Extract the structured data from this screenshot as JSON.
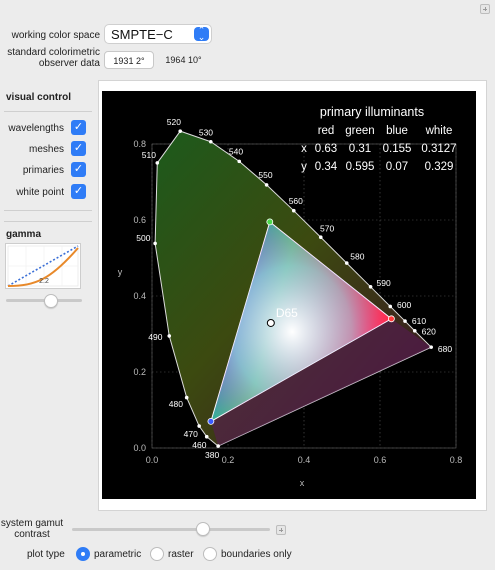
{
  "controls": {
    "working_color_space_label": "working color space",
    "working_color_space_value": "SMPTE−C",
    "observer_label_line1": "standard colorimetric",
    "observer_label_line2": "observer data",
    "observer_options": [
      "1931 2°",
      "1964 10°"
    ],
    "observer_selected": "1931 2°"
  },
  "visual_control": {
    "title": "visual control",
    "items": [
      {
        "label": "wavelengths",
        "checked": true
      },
      {
        "label": "meshes",
        "checked": true
      },
      {
        "label": "primaries",
        "checked": true
      },
      {
        "label": "white point",
        "checked": true
      }
    ]
  },
  "gamma": {
    "title": "gamma",
    "value_label": "2.2",
    "curve_color": "#e8892a",
    "reference_color": "#3a6fd6"
  },
  "table": {
    "title": "primary illuminants",
    "headers": [
      "red",
      "green",
      "blue",
      "white"
    ],
    "row_x_label": "x",
    "row_y_label": "y",
    "x_values": [
      "0.63",
      "0.31",
      "0.155",
      "0.3127"
    ],
    "y_values": [
      "0.34",
      "0.595",
      "0.07",
      "0.329"
    ]
  },
  "chart_data": {
    "type": "scatter",
    "title": "",
    "xlabel": "x",
    "ylabel": "y",
    "xlim": [
      0,
      0.8
    ],
    "ylim": [
      0,
      0.8
    ],
    "xticks": [
      "0.0",
      "0.2",
      "0.4",
      "0.6",
      "0.8"
    ],
    "yticks": [
      "0.0",
      "0.2",
      "0.4",
      "0.6",
      "0.8"
    ],
    "grid": true,
    "white_point_label": "D65",
    "white_point": [
      0.3127,
      0.329
    ],
    "primaries": {
      "red": [
        0.63,
        0.34
      ],
      "green": [
        0.31,
        0.595
      ],
      "blue": [
        0.155,
        0.07
      ]
    },
    "primary_colors": {
      "red": "#ff3b3b",
      "green": "#4cd94c",
      "blue": "#3a5bff"
    },
    "locus": [
      [
        380,
        0.1741,
        0.005
      ],
      [
        460,
        0.144,
        0.0297
      ],
      [
        470,
        0.1241,
        0.0578
      ],
      [
        480,
        0.0913,
        0.1327
      ],
      [
        490,
        0.0454,
        0.295
      ],
      [
        500,
        0.0082,
        0.5384
      ],
      [
        510,
        0.0139,
        0.7502
      ],
      [
        520,
        0.0743,
        0.8338
      ],
      [
        530,
        0.1547,
        0.8059
      ],
      [
        540,
        0.2296,
        0.7543
      ],
      [
        550,
        0.3016,
        0.6923
      ],
      [
        560,
        0.3731,
        0.6245
      ],
      [
        570,
        0.4441,
        0.5547
      ],
      [
        580,
        0.5125,
        0.4866
      ],
      [
        590,
        0.5752,
        0.4242
      ],
      [
        600,
        0.627,
        0.3725
      ],
      [
        610,
        0.6658,
        0.334
      ],
      [
        620,
        0.6915,
        0.3083
      ],
      [
        680,
        0.7347,
        0.2653
      ]
    ],
    "wavelength_labels": [
      "380",
      "460",
      "470",
      "480",
      "490",
      "500",
      "510",
      "520",
      "530",
      "540",
      "550",
      "560",
      "570",
      "580",
      "590",
      "600",
      "610",
      "620",
      "680"
    ]
  },
  "footer": {
    "system_gamut_label_line1": "system gamut",
    "system_gamut_label_line2": "contrast",
    "contrast_value": 0.5,
    "plot_type_label": "plot type",
    "plot_type_options": [
      "parametric",
      "raster",
      "boundaries only"
    ],
    "plot_type_selected": "parametric"
  }
}
